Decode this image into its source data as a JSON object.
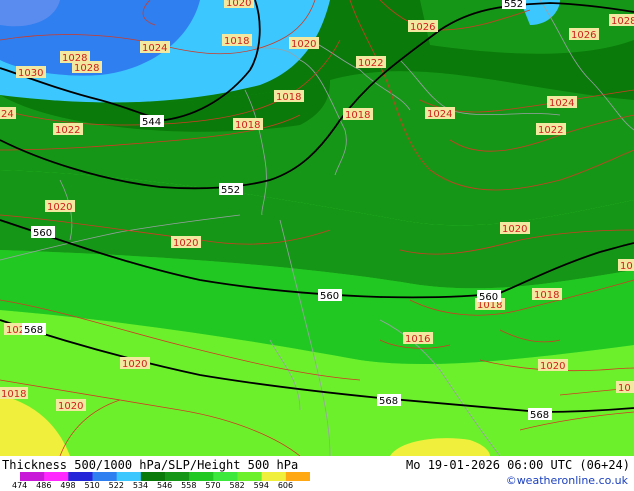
{
  "product": {
    "title": "Thickness 500/1000 hPa/SLP/Height 500 hPa",
    "datetime": "Mo 19-01-2026 06:00 UTC (06+24)",
    "credit": "©weatheronline.co.uk"
  },
  "legend": {
    "ticks": [
      "474",
      "486",
      "498",
      "510",
      "522",
      "534",
      "546",
      "558",
      "570",
      "582",
      "594",
      "606"
    ],
    "colors": [
      "#c818d8",
      "#ff28ff",
      "#2424d8",
      "#2f7ff0",
      "#3cc8ff",
      "#0a7a0a",
      "#169616",
      "#22c822",
      "#3ce83c",
      "#6cf02c",
      "#f0f03c",
      "#ffa814"
    ]
  },
  "slp_labels": [
    "1020",
    "1028",
    "1028",
    "1030",
    "1024",
    "1018",
    "1020",
    "1026",
    "1026",
    "1028",
    "1022",
    "1018",
    "24",
    "1022",
    "1018",
    "1018",
    "1024",
    "1024",
    "1022",
    "1020",
    "1020",
    "1020",
    "1018",
    "1018",
    "1020",
    "1020",
    "1016",
    "1020",
    "1018",
    "1020",
    "1018",
    "10",
    "10"
  ],
  "height_labels": [
    "552",
    "544",
    "552",
    "560",
    "560",
    "560",
    "568",
    "568",
    "568"
  ]
}
